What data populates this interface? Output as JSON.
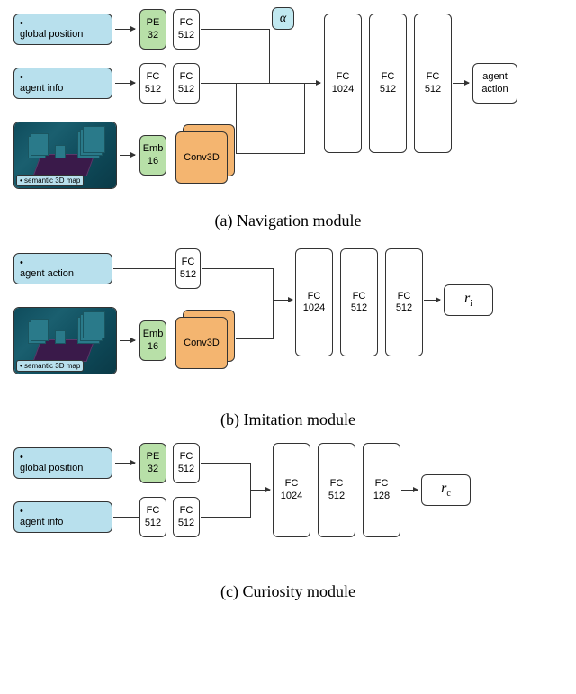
{
  "navigation": {
    "caption": "(a) Navigation module",
    "inputs": {
      "global_position": "global position",
      "agent_info": "agent info",
      "semantic_map": "semantic 3D map"
    },
    "blocks": {
      "pe": "PE\n32",
      "emb": "Emb\n16",
      "fc512": "FC\n512",
      "fc1024": "FC\n1024",
      "conv3d": "Conv3D",
      "alpha": "α"
    },
    "output": "agent action"
  },
  "imitation": {
    "caption": "(b) Imitation module",
    "inputs": {
      "agent_action": "agent action",
      "semantic_map": "semantic 3D map"
    },
    "blocks": {
      "emb": "Emb\n16",
      "fc512": "FC\n512",
      "fc1024": "FC\n1024",
      "conv3d": "Conv3D"
    },
    "output": "rᵢ"
  },
  "curiosity": {
    "caption": "(c) Curiosity module",
    "inputs": {
      "global_position": "global position",
      "agent_info": "agent info"
    },
    "blocks": {
      "pe": "PE\n32",
      "fc512": "FC\n512",
      "fc1024": "FC\n1024",
      "fc128": "FC\n128"
    },
    "output": "rc"
  }
}
